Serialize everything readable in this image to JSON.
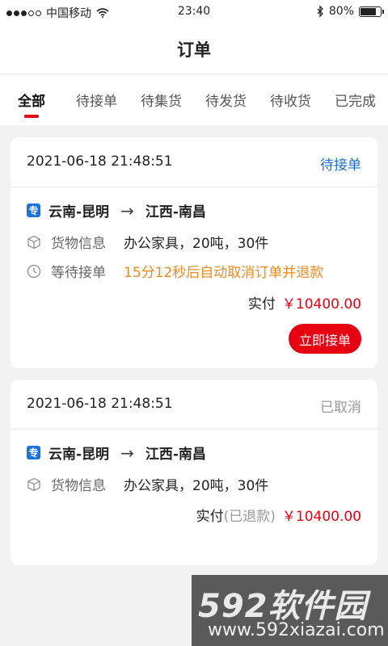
{
  "status_bar": {
    "carrier": "中国移动",
    "time": "23:40",
    "battery": "80%"
  },
  "header": {
    "title": "订单"
  },
  "tabs": [
    {
      "label": "全部",
      "active": true
    },
    {
      "label": "待接单",
      "active": false
    },
    {
      "label": "待集货",
      "active": false
    },
    {
      "label": "待发货",
      "active": false
    },
    {
      "label": "待收货",
      "active": false
    },
    {
      "label": "已完成",
      "active": false
    }
  ],
  "orders": [
    {
      "datetime": "2021-06-18  21:48:51",
      "status": "待接单",
      "status_color": "#1a6fc9",
      "badge": "专",
      "from": "云南-昆明",
      "to": "江西-南昌",
      "goods_label": "货物信息",
      "goods_value": "办公家具，20吨，30件",
      "wait_label": "等待接单",
      "wait_value": "15分12秒后自动取消订单并退款",
      "pay_label": "实付",
      "pay_note": "",
      "amount": "￥10400.00",
      "action": "立即接单"
    },
    {
      "datetime": "2021-06-18  21:48:51",
      "status": "已取消",
      "status_color": "#999999",
      "badge": "专",
      "from": "云南-昆明",
      "to": "江西-南昌",
      "goods_label": "货物信息",
      "goods_value": "办公家具，20吨，30件",
      "pay_label": "实付",
      "pay_note": "(已退款)",
      "amount": "￥10400.00"
    }
  ],
  "watermark": {
    "brand": "592软件园",
    "url": "www.592xiazai.com"
  },
  "colors": {
    "accent_red": "#e60012",
    "link_blue": "#1a6fc9",
    "warn_orange": "#ef8a1e"
  }
}
